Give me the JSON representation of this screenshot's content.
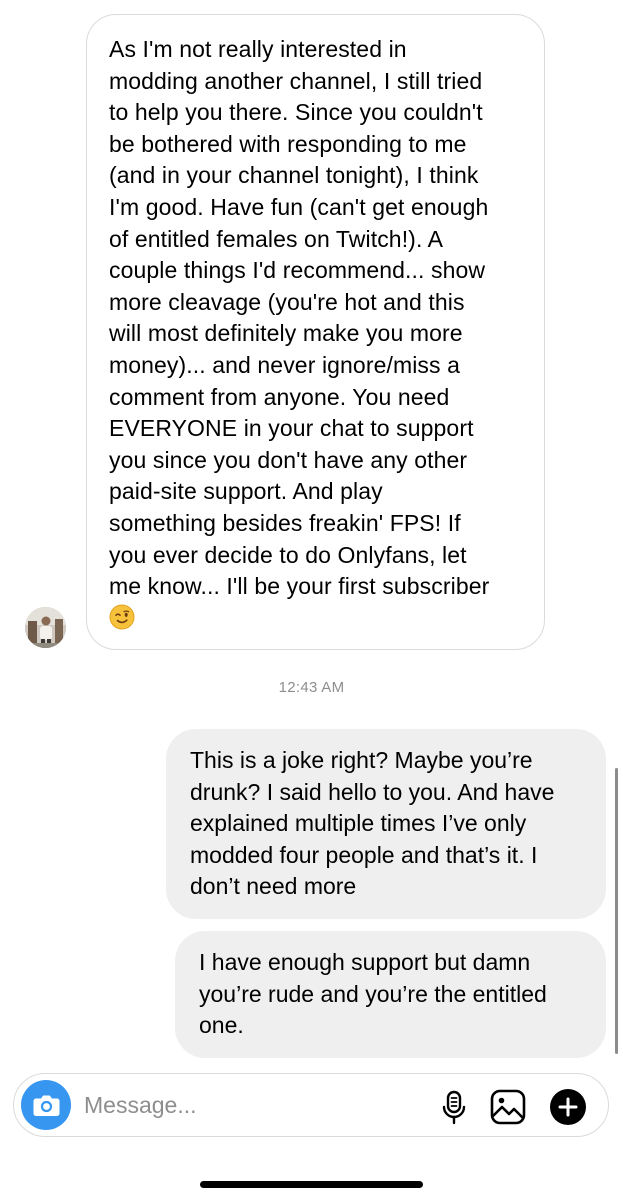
{
  "thread": {
    "incoming_message": "As I'm not really interested in\nmodding another channel, I still tried\nto help you there. Since you couldn't\nbe bothered with responding to me\n(and in your channel tonight), I think\nI'm good. Have fun (can't get enough\nof entitled females on Twitch!). A\ncouple things I'd recommend... show\nmore cleavage (you're hot and this\nwill most definitely make you more\nmoney)... and never ignore/miss a\ncomment from anyone. You need\nEVERYONE in your chat to support\nyou since you don't have any other\npaid-site support. And play\nsomething besides freakin' FPS! If\nyou ever decide to do Onlyfans, let\nme know... I'll be your first subscriber",
    "incoming_emoji": "winking-face",
    "timestamp": "12:43 AM",
    "outgoing_messages": [
      "This is a joke right? Maybe you’re\ndrunk? I said hello to you. And have\nexplained multiple times I’ve only\nmodded four people and that’s it. I\ndon’t need more",
      "I have enough support but damn\nyou’re rude and you’re the entitled\none."
    ]
  },
  "composer": {
    "placeholder": "Message...",
    "camera_icon": "camera-icon",
    "mic_icon": "microphone-icon",
    "gallery_icon": "image-gallery-icon",
    "plus_icon": "plus-circle-icon"
  },
  "colors": {
    "accent_blue": "#3797f0",
    "outgoing_bubble": "#efefef",
    "incoming_border": "#dbdbdb",
    "timestamp_gray": "#8e8e8e"
  }
}
